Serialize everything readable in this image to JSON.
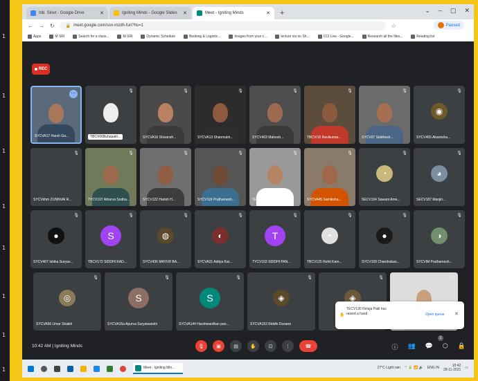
{
  "left_strip": [
    "1",
    "1",
    "1",
    "1",
    "1",
    "1",
    "1",
    "1"
  ],
  "browser": {
    "tabs": [
      {
        "label": "Inb. Sinet - Google Drive",
        "active": false,
        "color": "#4285f4"
      },
      {
        "label": "Igniting Minds - Google Slides",
        "active": false,
        "color": "#fbbc04"
      },
      {
        "label": "Meet - Igniting Minds",
        "active": true,
        "color": "#00897b"
      }
    ],
    "window_controls": [
      "⌄",
      "–",
      "▢",
      "✕"
    ],
    "url": "meet.google.com/ssn-mzdh-fun?hs=1",
    "profile_label": "Paused",
    "bookmarks": [
      "Apps",
      "M SRI",
      "Search for a class...",
      "M SRI",
      "Dynamic Schedule",
      "Booking & Logistic...",
      "Images from your c...",
      "lecture via on Sh...",
      "CCI Live - Google...",
      "Research all the files...",
      "Reading list"
    ]
  },
  "meet": {
    "rec_label": "REC",
    "tiles": [
      {
        "name": "SYCVA17 Harsh Ga...",
        "type": "video",
        "skin": "#a8765a",
        "shirt": "#34495e",
        "bg": "#5b6a7a",
        "pinned": true
      },
      {
        "name": "TBCV06Buhapatil...",
        "type": "video",
        "skin": "#eeeeee",
        "shirt": "#3c4043",
        "bg": "#3c4043",
        "highlight": true
      },
      {
        "name": "SYCVA16 Shivansh...",
        "type": "video",
        "skin": "#b98062",
        "shirt": "#3b3b3b",
        "bg": "#4a4a4a"
      },
      {
        "name": "SYCVA13 Shanmukh...",
        "type": "video",
        "skin": "#8d5a3e",
        "shirt": "#2d2d2d",
        "bg": "#2c2c2c"
      },
      {
        "name": "SYCV403 Mahesh...",
        "type": "video",
        "skin": "#9c6a4e",
        "shirt": "#3a3a3a",
        "bg": "#4d4d4d"
      },
      {
        "name": "TBCV/16 Ravikumar...",
        "type": "video",
        "skin": "#8a5a3f",
        "shirt": "#c0392b",
        "bg": "#5c4c3c"
      },
      {
        "name": "SYCV07 Siddhesh...",
        "type": "video",
        "skin": "#a66f52",
        "shirt": "#4b6584",
        "bg": "#6b6b6b"
      },
      {
        "name": "SYCV405 Akanksha...",
        "type": "avatar",
        "avatar": "◉",
        "color": "#6d5a2a"
      },
      {
        "name": "SYCVkhm 21/NNVAI R...",
        "type": "blank"
      },
      {
        "name": "TYCV107 Atharva Sodha...",
        "type": "video",
        "skin": "#9b6b4c",
        "shirt": "#2f4f4f",
        "bg": "#6e7a5a"
      },
      {
        "name": "SYCV122 Harish H...",
        "type": "video",
        "skin": "#8e5d42",
        "shirt": "#3d3d3d",
        "bg": "#6f6f6f"
      },
      {
        "name": "SYCV116 Prathamesh...",
        "type": "video",
        "skin": "#6f4a34",
        "shirt": "#3c6e8f",
        "bg": "#555555"
      },
      {
        "name": "TECV075 Prasad R...",
        "type": "video",
        "skin": "#b58465",
        "shirt": "#ffffff",
        "bg": "#9a9a9a"
      },
      {
        "name": "SYCVA45 Samiksha...",
        "type": "video",
        "skin": "#a0684a",
        "shirt": "#d35400",
        "bg": "#8a7a6a"
      },
      {
        "name": "SECV104 Sawant Ame...",
        "type": "avatar",
        "avatar": "◔",
        "color": "#c8b87a"
      },
      {
        "name": "SECV187 Manjiri...",
        "type": "avatar",
        "avatar": "◕",
        "color": "#7a8fa0"
      },
      {
        "name": "SYCV407 Ishika Suryav...",
        "type": "avatar",
        "avatar": "●",
        "color": "#111111"
      },
      {
        "name": "TBCV172 SIDDHI KAD...",
        "type": "letter",
        "letter": "S",
        "color": "#a142f4"
      },
      {
        "name": "SYCV436 MAYUR BA...",
        "type": "avatar",
        "avatar": "◍",
        "color": "#5a4a2a"
      },
      {
        "name": "SYCVA31 Aditya Kar...",
        "type": "avatar",
        "avatar": "◐",
        "color": "#7a2e2e"
      },
      {
        "name": "TYCV103 SIDDHI PAN...",
        "type": "letter",
        "letter": "T",
        "color": "#a142f4"
      },
      {
        "name": "TBCV125 Rohit Kam...",
        "type": "avatar",
        "avatar": "◓",
        "color": "#e0e0e0"
      },
      {
        "name": "SYCV109 Chandrakan...",
        "type": "avatar",
        "avatar": "●",
        "color": "#1a1a1a"
      },
      {
        "name": "SYCVIM Prathamesh...",
        "type": "avatar",
        "avatar": "◑",
        "color": "#6f8f6f"
      },
      {
        "name": "SYCVA56 Umar Shaikh",
        "type": "avatar",
        "avatar": "◎",
        "color": "#8a7a5a"
      },
      {
        "name": "SYCVA16a Apurva Suryawanshi",
        "type": "letter",
        "letter": "S",
        "color": "#8d6e63"
      },
      {
        "name": "SYCVA144 Harshwardhan pan...",
        "type": "letter",
        "letter": "S",
        "color": "#00897b"
      },
      {
        "name": "SYCVA153 Riddhi Dusane",
        "type": "avatar",
        "avatar": "◈",
        "color": "#5a4a2a"
      },
      {
        "name": "",
        "type": "avatar",
        "avatar": "◈",
        "color": "#6a5a3a"
      },
      {
        "name": "",
        "type": "video",
        "skin": "#c9a07e",
        "shirt": "#cccccc",
        "bg": "#dddddd"
      }
    ],
    "toast": {
      "text": "TECV130 Reluja Patil has raised a hand",
      "link": "Open queue",
      "close": "✕",
      "icon": "✋"
    },
    "time": "10:42 AM",
    "separator": "|",
    "meeting_name": "Igniting Minds",
    "hand_count": "1"
  },
  "taskbar": {
    "app_label": "Meet - Igniting Min...",
    "weather": "27°C Light rain",
    "time": "10:42",
    "date": "28-11-2021",
    "lang": "ENG IN"
  }
}
